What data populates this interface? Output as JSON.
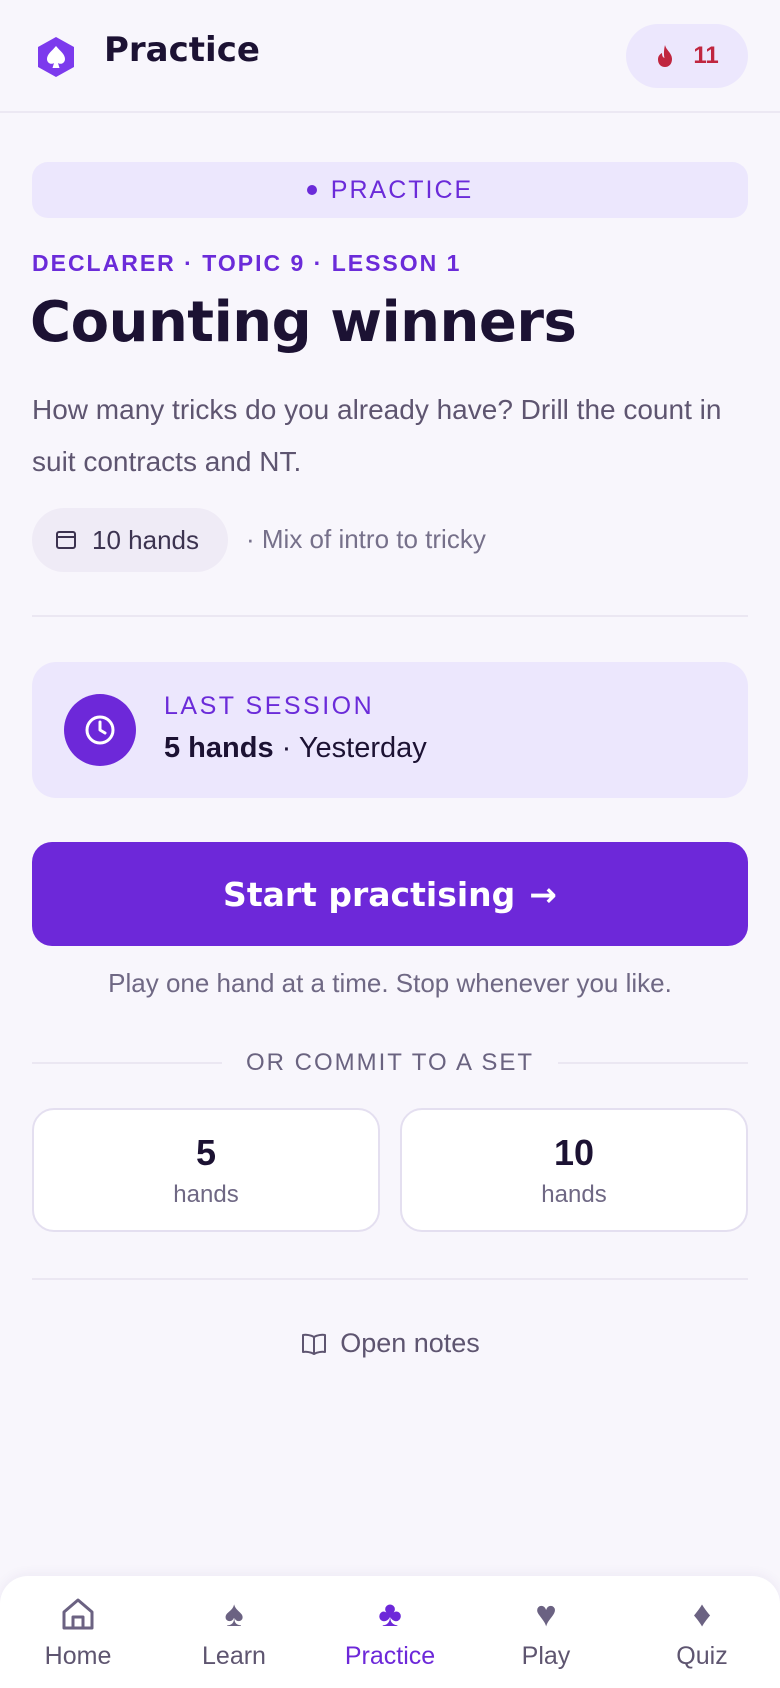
{
  "header": {
    "title": "Practice",
    "streak_count": "11",
    "logo_icon": "spade-hexagon-logo",
    "streak_icon": "flame-icon"
  },
  "badge": {
    "label": "PRACTICE"
  },
  "lesson": {
    "eyebrow": "DECLARER · TOPIC 9 · LESSON 1",
    "title": "Counting winners",
    "description": "How many tricks do you already have? Drill the count in suit contracts and NT.",
    "hands_chip": "10 hands",
    "difficulty_note": "· Mix of intro to tricky"
  },
  "last_session": {
    "label": "LAST SESSION",
    "hands": "5 hands",
    "when": "· Yesterday"
  },
  "cta": {
    "label": "Start practising",
    "arrow": "→",
    "hint": "Play one hand at a time. Stop whenever you like."
  },
  "sets": {
    "heading": "OR COMMIT TO A SET",
    "options": [
      {
        "count": "5",
        "unit": "hands"
      },
      {
        "count": "10",
        "unit": "hands"
      }
    ]
  },
  "notes": {
    "label": "Open notes"
  },
  "tabs": [
    {
      "label": "Home",
      "icon": "home-icon"
    },
    {
      "label": "Learn",
      "icon": "spade-icon"
    },
    {
      "label": "Practice",
      "icon": "club-icon",
      "active": true
    },
    {
      "label": "Play",
      "icon": "heart-icon"
    },
    {
      "label": "Quiz",
      "icon": "diamond-icon"
    }
  ],
  "colors": {
    "accent": "#6d28d9",
    "accent_soft": "#ece7fd",
    "streak": "#c0263f",
    "background": "#f8f6fc"
  }
}
